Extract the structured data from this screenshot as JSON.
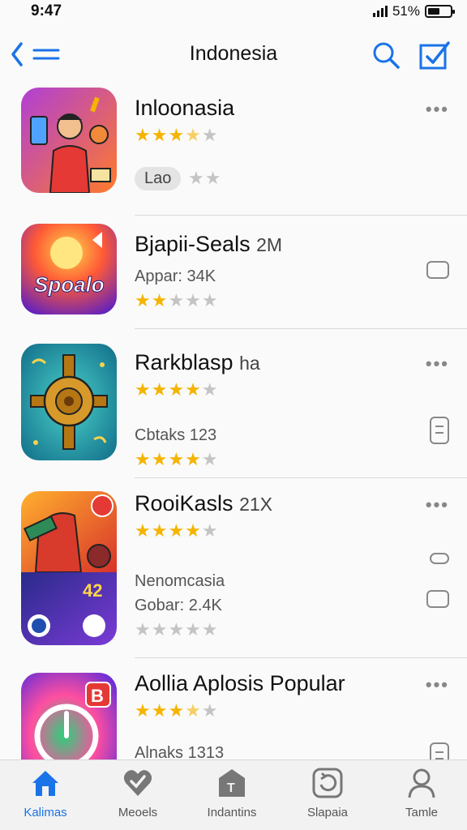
{
  "status": {
    "time": "9:47",
    "battery": "51%"
  },
  "nav": {
    "title": "Indonesia"
  },
  "apps": [
    {
      "title": "Inloonasia",
      "meta": "",
      "pill": "Lao",
      "rating_1": 3.5,
      "rating_2": 2,
      "icon": "person-with-phone-icon"
    },
    {
      "title": "Bjapii-Seals",
      "meta": "2M",
      "subtitle": "Appar: 34K",
      "rating_1": 2,
      "icon": "sun-burst-logo-icon",
      "icon_text": "Spoalo"
    },
    {
      "title": "Rarkblasp",
      "meta": "ha",
      "subtitle": "Cbtaks 123",
      "rating_1": 4,
      "rating_2": 4,
      "icon": "golden-medallion-icon"
    },
    {
      "title": "RooiKasls",
      "meta": "21X",
      "subtitle": "Nenomcasia",
      "subtitle_2": "Gobar: 2.4K",
      "rating_1": 4,
      "rating_2": 0,
      "icon": "red-character-icon",
      "icon_text": "42"
    },
    {
      "title": "Aollia Aplosis Popular",
      "meta": "",
      "subtitle": "Alnaks 1313",
      "rating_1": 3.5,
      "icon": "colorful-timer-icon",
      "icon_text": "B"
    }
  ],
  "tabs": [
    {
      "label": "Kalimas",
      "icon": "home-icon"
    },
    {
      "label": "Meoels",
      "icon": "heart-icon"
    },
    {
      "label": "Indantins",
      "icon": "tag-icon"
    },
    {
      "label": "Slapaia",
      "icon": "refresh-icon"
    },
    {
      "label": "Tamle",
      "icon": "person-icon"
    }
  ],
  "colors": {
    "accent": "#1a73e8",
    "star": "#f5b400"
  }
}
